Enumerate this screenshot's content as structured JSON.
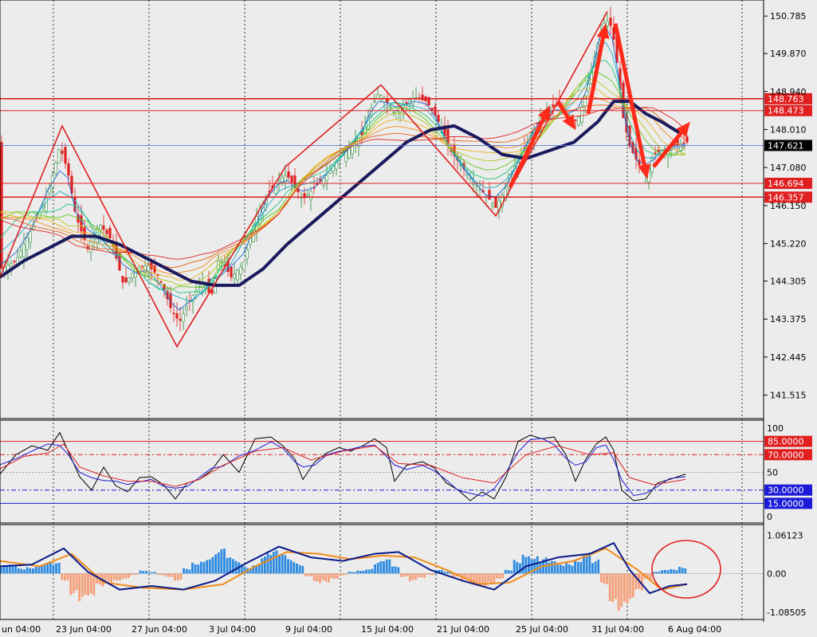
{
  "chart_data": [
    {
      "type": "candlestick",
      "price_ticks": [
        "150.785",
        "149.870",
        "148.940",
        "148.010",
        "147.080",
        "146.150",
        "145.220",
        "144.305",
        "143.375",
        "142.445",
        "141.515"
      ],
      "price_range": [
        141.0,
        151.1
      ],
      "current_price": "147.621",
      "levels": [
        {
          "label": "148.763",
          "value": 148.763,
          "color": "#e02020"
        },
        {
          "label": "148.473",
          "value": 148.473,
          "color": "#e02020"
        },
        {
          "label": "146.694",
          "value": 146.694,
          "color": "#e02020"
        },
        {
          "label": "146.357",
          "value": 146.357,
          "color": "#e02020"
        }
      ],
      "zigzag": [
        [
          0,
          144.4
        ],
        [
          78,
          148.1
        ],
        [
          222,
          142.7
        ],
        [
          358,
          147.1
        ],
        [
          478,
          149.1
        ],
        [
          622,
          145.9
        ],
        [
          762,
          150.9
        ]
      ],
      "arrows": [
        [
          640,
          146.6,
          690,
          148.6
        ],
        [
          700,
          148.7,
          722,
          148.0
        ],
        [
          738,
          148.4,
          760,
          150.6
        ],
        [
          772,
          150.6,
          812,
          146.8
        ],
        [
          820,
          147.1,
          866,
          148.2
        ]
      ],
      "close_path": [
        [
          0,
          144.6
        ],
        [
          20,
          144.8
        ],
        [
          40,
          145.6
        ],
        [
          60,
          146.4
        ],
        [
          75,
          147.6
        ],
        [
          85,
          147.0
        ],
        [
          95,
          145.9
        ],
        [
          110,
          145.1
        ],
        [
          125,
          145.7
        ],
        [
          140,
          145.3
        ],
        [
          155,
          144.2
        ],
        [
          170,
          144.6
        ],
        [
          185,
          144.7
        ],
        [
          200,
          144.4
        ],
        [
          215,
          143.6
        ],
        [
          225,
          143.3
        ],
        [
          240,
          143.9
        ],
        [
          255,
          144.3
        ],
        [
          265,
          143.9
        ],
        [
          275,
          144.9
        ],
        [
          290,
          144.4
        ],
        [
          305,
          144.7
        ],
        [
          320,
          145.8
        ],
        [
          335,
          146.4
        ],
        [
          350,
          146.8
        ],
        [
          360,
          146.9
        ],
        [
          370,
          146.6
        ],
        [
          380,
          146.3
        ],
        [
          395,
          146.6
        ],
        [
          410,
          146.9
        ],
        [
          425,
          147.3
        ],
        [
          440,
          147.6
        ],
        [
          455,
          147.9
        ],
        [
          465,
          148.5
        ],
        [
          475,
          148.9
        ],
        [
          485,
          148.7
        ],
        [
          495,
          148.4
        ],
        [
          505,
          148.6
        ],
        [
          520,
          148.8
        ],
        [
          535,
          148.7
        ],
        [
          545,
          148.4
        ],
        [
          555,
          148.0
        ],
        [
          565,
          147.5
        ],
        [
          580,
          147.1
        ],
        [
          595,
          146.7
        ],
        [
          610,
          146.4
        ],
        [
          622,
          146.1
        ],
        [
          635,
          146.6
        ],
        [
          648,
          147.2
        ],
        [
          660,
          147.6
        ],
        [
          672,
          148.1
        ],
        [
          685,
          148.5
        ],
        [
          700,
          148.6
        ],
        [
          712,
          148.4
        ],
        [
          724,
          148.2
        ],
        [
          735,
          148.9
        ],
        [
          745,
          149.7
        ],
        [
          752,
          150.3
        ],
        [
          760,
          150.7
        ],
        [
          768,
          150.5
        ],
        [
          775,
          149.5
        ],
        [
          782,
          148.3
        ],
        [
          790,
          147.6
        ],
        [
          800,
          147.2
        ],
        [
          810,
          146.9
        ],
        [
          820,
          147.4
        ],
        [
          830,
          147.5
        ],
        [
          845,
          147.6
        ],
        [
          860,
          147.7
        ]
      ],
      "ma_path": [
        [
          0,
          144.4
        ],
        [
          30,
          144.8
        ],
        [
          60,
          145.1
        ],
        [
          90,
          145.4
        ],
        [
          120,
          145.4
        ],
        [
          150,
          145.2
        ],
        [
          180,
          144.9
        ],
        [
          210,
          144.6
        ],
        [
          240,
          144.3
        ],
        [
          270,
          144.2
        ],
        [
          300,
          144.2
        ],
        [
          330,
          144.6
        ],
        [
          360,
          145.2
        ],
        [
          390,
          145.7
        ],
        [
          420,
          146.2
        ],
        [
          450,
          146.7
        ],
        [
          480,
          147.2
        ],
        [
          510,
          147.7
        ],
        [
          540,
          148.0
        ],
        [
          570,
          148.1
        ],
        [
          600,
          147.8
        ],
        [
          630,
          147.4
        ],
        [
          660,
          147.3
        ],
        [
          690,
          147.5
        ],
        [
          720,
          147.7
        ],
        [
          750,
          148.2
        ],
        [
          770,
          148.7
        ],
        [
          790,
          148.7
        ],
        [
          810,
          148.4
        ],
        [
          830,
          148.2
        ],
        [
          855,
          147.9
        ]
      ]
    },
    {
      "type": "line",
      "oscillator_ticks": [
        "100",
        "50",
        "0"
      ],
      "levels": [
        {
          "label": "85.0000",
          "value": 85,
          "color": "#e02020",
          "style": "solid"
        },
        {
          "label": "70.0000",
          "value": 70,
          "color": "#e02020",
          "style": "dashdot"
        },
        {
          "label": "30.0000",
          "value": 30,
          "color": "#1a1ad8",
          "style": "dashdot"
        },
        {
          "label": "15.0000",
          "value": 15,
          "color": "#1a1ad8",
          "style": "solid"
        }
      ],
      "k_path": [
        [
          0,
          48
        ],
        [
          20,
          70
        ],
        [
          40,
          80
        ],
        [
          60,
          75
        ],
        [
          75,
          95
        ],
        [
          85,
          75
        ],
        [
          100,
          45
        ],
        [
          115,
          30
        ],
        [
          130,
          56
        ],
        [
          145,
          35
        ],
        [
          160,
          28
        ],
        [
          175,
          44
        ],
        [
          190,
          45
        ],
        [
          205,
          36
        ],
        [
          220,
          20
        ],
        [
          235,
          38
        ],
        [
          250,
          42
        ],
        [
          265,
          52
        ],
        [
          280,
          70
        ],
        [
          300,
          50
        ],
        [
          320,
          88
        ],
        [
          340,
          90
        ],
        [
          355,
          80
        ],
        [
          370,
          65
        ],
        [
          380,
          42
        ],
        [
          395,
          62
        ],
        [
          410,
          72
        ],
        [
          425,
          78
        ],
        [
          440,
          74
        ],
        [
          455,
          80
        ],
        [
          470,
          88
        ],
        [
          485,
          78
        ],
        [
          495,
          40
        ],
        [
          510,
          58
        ],
        [
          530,
          62
        ],
        [
          545,
          55
        ],
        [
          560,
          38
        ],
        [
          575,
          30
        ],
        [
          590,
          18
        ],
        [
          605,
          28
        ],
        [
          620,
          20
        ],
        [
          635,
          45
        ],
        [
          650,
          85
        ],
        [
          665,
          92
        ],
        [
          680,
          88
        ],
        [
          695,
          90
        ],
        [
          710,
          70
        ],
        [
          722,
          40
        ],
        [
          735,
          65
        ],
        [
          748,
          82
        ],
        [
          760,
          90
        ],
        [
          770,
          75
        ],
        [
          780,
          30
        ],
        [
          795,
          18
        ],
        [
          810,
          20
        ],
        [
          825,
          38
        ],
        [
          840,
          42
        ],
        [
          860,
          48
        ]
      ],
      "d_path": [
        [
          0,
          54
        ],
        [
          30,
          68
        ],
        [
          60,
          72
        ],
        [
          80,
          82
        ],
        [
          100,
          56
        ],
        [
          130,
          46
        ],
        [
          160,
          40
        ],
        [
          190,
          40
        ],
        [
          220,
          34
        ],
        [
          250,
          42
        ],
        [
          280,
          58
        ],
        [
          320,
          74
        ],
        [
          355,
          78
        ],
        [
          390,
          64
        ],
        [
          430,
          74
        ],
        [
          470,
          80
        ],
        [
          500,
          60
        ],
        [
          540,
          58
        ],
        [
          580,
          44
        ],
        [
          620,
          38
        ],
        [
          660,
          70
        ],
        [
          700,
          80
        ],
        [
          740,
          70
        ],
        [
          770,
          72
        ],
        [
          790,
          44
        ],
        [
          820,
          36
        ],
        [
          860,
          42
        ]
      ]
    },
    {
      "type": "bar",
      "macd_ticks": [
        "1.06123",
        "0.00",
        "-1.08505"
      ],
      "value_range": [
        -1.15,
        1.12
      ],
      "histogram": [
        0.2,
        0.25,
        0.15,
        0.2,
        0.25,
        0.35,
        0.3,
        -0.2,
        -0.6,
        -0.85,
        -0.8,
        -0.4,
        -0.25,
        -0.2,
        -0.15,
        -0.05,
        0.1,
        0.05,
        -0.05,
        -0.1,
        -0.2,
        0.15,
        0.35,
        0.45,
        0.55,
        0.7,
        0.45,
        0.35,
        0.2,
        0.3,
        0.6,
        0.65,
        0.55,
        0.4,
        0.3,
        -0.1,
        -0.3,
        -0.25,
        -0.15,
        -0.05,
        0.05,
        0.1,
        0.15,
        0.35,
        0.4,
        0.2,
        -0.1,
        -0.25,
        -0.15,
        -0.05,
        0.1,
        0.05,
        -0.1,
        -0.2,
        -0.35,
        -0.4,
        -0.3,
        -0.15,
        0.1,
        0.4,
        0.65,
        0.55,
        0.45,
        0.35,
        0.25,
        0.3,
        0.45,
        0.7,
        0.4,
        -0.3,
        -0.8,
        -1.05,
        -0.95,
        -0.6,
        -0.2,
        0.05,
        0.1,
        0.12,
        0.2
      ],
      "macd_path": [
        [
          0,
          0.2
        ],
        [
          40,
          0.25
        ],
        [
          80,
          0.7
        ],
        [
          110,
          0.05
        ],
        [
          150,
          -0.45
        ],
        [
          190,
          -0.35
        ],
        [
          230,
          -0.45
        ],
        [
          270,
          -0.2
        ],
        [
          310,
          0.3
        ],
        [
          350,
          0.75
        ],
        [
          390,
          0.45
        ],
        [
          430,
          0.35
        ],
        [
          470,
          0.55
        ],
        [
          500,
          0.6
        ],
        [
          540,
          0.1
        ],
        [
          580,
          -0.2
        ],
        [
          620,
          -0.45
        ],
        [
          660,
          0.2
        ],
        [
          700,
          0.45
        ],
        [
          740,
          0.55
        ],
        [
          770,
          0.85
        ],
        [
          790,
          0.1
        ],
        [
          815,
          -0.55
        ],
        [
          840,
          -0.35
        ],
        [
          862,
          -0.3
        ]
      ],
      "signal_path": [
        [
          0,
          0.35
        ],
        [
          50,
          0.2
        ],
        [
          90,
          0.55
        ],
        [
          130,
          -0.25
        ],
        [
          180,
          -0.4
        ],
        [
          230,
          -0.45
        ],
        [
          280,
          -0.3
        ],
        [
          320,
          0.2
        ],
        [
          360,
          0.6
        ],
        [
          400,
          0.55
        ],
        [
          440,
          0.4
        ],
        [
          480,
          0.5
        ],
        [
          520,
          0.45
        ],
        [
          560,
          0.1
        ],
        [
          600,
          -0.3
        ],
        [
          640,
          -0.25
        ],
        [
          680,
          0.2
        ],
        [
          720,
          0.35
        ],
        [
          760,
          0.7
        ],
        [
          800,
          0.1
        ],
        [
          830,
          -0.45
        ],
        [
          862,
          -0.3
        ]
      ]
    }
  ],
  "time_axis": [
    "un 04:00",
    "23 Jun 04:00",
    "27 Jun 04:00",
    "3 Jul 04:00",
    "9 Jul 04:00",
    "15 Jul 04:00",
    "21 Jul 04:00",
    "25 Jul 04:00",
    "31 Jul 04:00",
    "6 Aug 04:00"
  ],
  "colors": {
    "background": "#ececec",
    "bull": "#2a8a3a",
    "bear": "#e02020",
    "ma": "#1a1a5e",
    "macd": "#1a1ad8",
    "signal": "#f08c1a",
    "hist_up": "#2e8be0",
    "hist_down": "#f4a07a",
    "current": "#000000"
  }
}
